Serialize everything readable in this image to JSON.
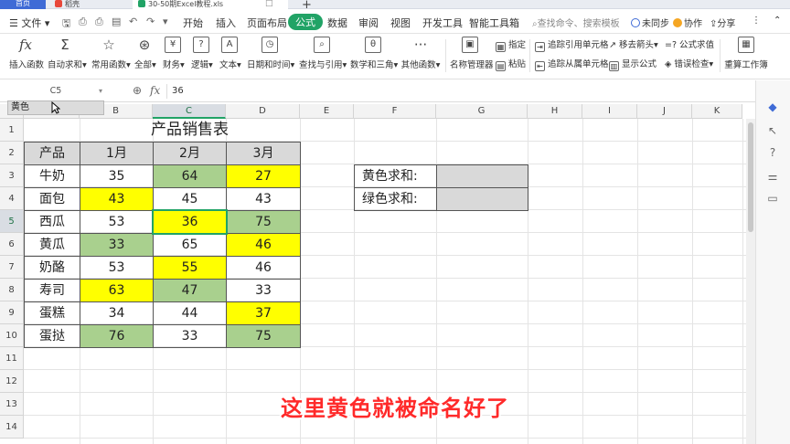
{
  "tabs": {
    "home": "首页",
    "wps": "稻壳",
    "file": "30-50期Excel教程.xls"
  },
  "menu": {
    "file_label": "文件",
    "items": [
      "开始",
      "插入",
      "页面布局",
      "公式",
      "数据",
      "审阅",
      "视图",
      "开发工具",
      "智能工具箱"
    ],
    "active_item": "公式",
    "search_placeholder": "查找命令、搜索模板",
    "sync": "未同步",
    "collab": "协作",
    "share": "分享"
  },
  "ribbon": {
    "buttons": [
      "插入函数",
      "自动求和",
      "常用函数",
      "全部",
      "财务",
      "逻辑",
      "文本",
      "日期和时间",
      "查找与引用",
      "数学和三角",
      "其他函数",
      "名称管理器"
    ],
    "small": {
      "assign": "指定",
      "paste": "粘贴",
      "trace_precedents": "追踪引用单元格",
      "trace_dependents": "追踪从属单元格",
      "remove_arrows": "移去箭头",
      "show_formulas": "显示公式",
      "evaluate": "公式求值",
      "error_check": "错误检查",
      "recalc": "重算工作簿"
    }
  },
  "formula_bar": {
    "name_box": "C5",
    "value": "36",
    "fx": "fx"
  },
  "autocomplete": {
    "item": "黄色"
  },
  "columns": [
    "A",
    "B",
    "C",
    "D",
    "E",
    "F",
    "G",
    "H",
    "I",
    "J",
    "K"
  ],
  "rows": [
    "1",
    "2",
    "3",
    "4",
    "5",
    "6",
    "7",
    "8",
    "9",
    "10",
    "11",
    "12",
    "13",
    "14"
  ],
  "selected": {
    "column": "C",
    "row": "5"
  },
  "sheet": {
    "title": "产品销售表",
    "header": [
      "产品",
      "1月",
      "2月",
      "3月"
    ],
    "rows": [
      {
        "name": "牛奶",
        "values": [
          "35",
          "64",
          "27"
        ],
        "colors": [
          "",
          "green",
          "yellow"
        ]
      },
      {
        "name": "面包",
        "values": [
          "43",
          "45",
          "43"
        ],
        "colors": [
          "yellow",
          "",
          ""
        ]
      },
      {
        "name": "西瓜",
        "values": [
          "53",
          "36",
          "75"
        ],
        "colors": [
          "",
          "yellow",
          "green"
        ]
      },
      {
        "name": "黄瓜",
        "values": [
          "33",
          "65",
          "46"
        ],
        "colors": [
          "green",
          "",
          "yellow"
        ]
      },
      {
        "name": "奶酪",
        "values": [
          "53",
          "55",
          "46"
        ],
        "colors": [
          "",
          "yellow",
          ""
        ]
      },
      {
        "name": "寿司",
        "values": [
          "63",
          "47",
          "33"
        ],
        "colors": [
          "yellow",
          "green",
          ""
        ]
      },
      {
        "name": "蛋糕",
        "values": [
          "34",
          "44",
          "37"
        ],
        "colors": [
          "",
          "",
          "yellow"
        ]
      },
      {
        "name": "蛋挞",
        "values": [
          "76",
          "33",
          "75"
        ],
        "colors": [
          "green",
          "",
          "green"
        ]
      }
    ],
    "summary": [
      {
        "label": "黄色求和:",
        "value": ""
      },
      {
        "label": "绿色求和:",
        "value": ""
      }
    ]
  },
  "colors": {
    "accent": "#21a366",
    "yellow_fill": "#ffff00",
    "green_fill": "#a9d08e",
    "header_fill": "#d9d9d9"
  },
  "subtitle": "这里黄色就被命名好了"
}
